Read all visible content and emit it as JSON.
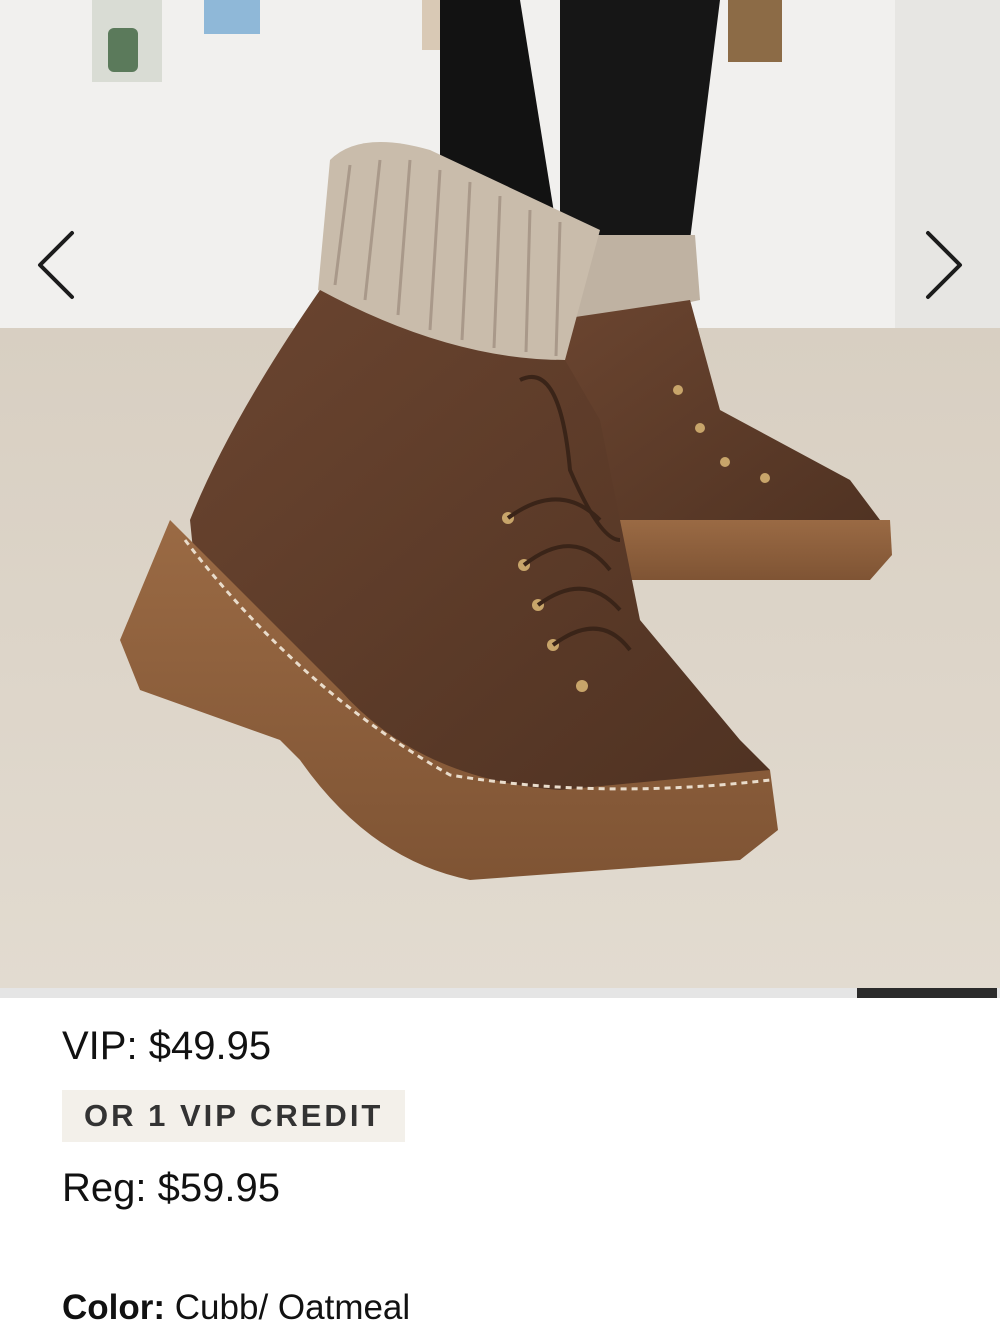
{
  "gallery": {
    "prev_icon": "chevron-left-icon",
    "next_icon": "chevron-right-icon",
    "image_subject": "Brown suede lace-up lug sole boots with oatmeal knit cuff",
    "progress_fraction": 0.14
  },
  "pricing": {
    "vip_label": "VIP:",
    "vip_price": "$49.95",
    "credit_text": "OR 1 VIP CREDIT",
    "reg_label": "Reg:",
    "reg_price": "$59.95"
  },
  "color": {
    "label": "Color:",
    "value": "Cubb/ Oatmeal"
  }
}
